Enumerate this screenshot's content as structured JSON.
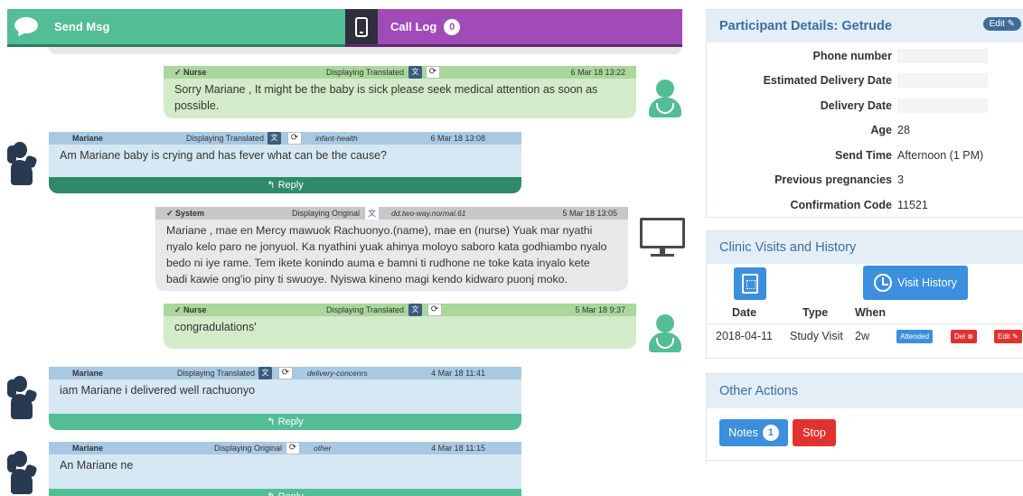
{
  "topbar": {
    "send_label": "Send Msg",
    "call_label": "Call Log",
    "call_count": "0",
    "send_color": "#53bd96",
    "call_color": "#a14bb8"
  },
  "feed": {
    "msg1": {
      "from": "✓ Nurse",
      "display": "Displaying Translated",
      "date": "6 Mar 18 13:22",
      "text": "Sorry Mariane , It might be the baby is sick please seek medical attention as soon as possible."
    },
    "msg2": {
      "from": "Mariane",
      "display": "Displaying Translated",
      "tag": "infant-health",
      "date": "6 Mar 18 13:08",
      "text": "Am Mariane baby is crying and has fever what can be the cause?",
      "reply": "↰ Reply"
    },
    "msg3": {
      "from": "✓ System",
      "display": "Displaying Original",
      "tag": "dd.two-way.normal.61",
      "date": "5 Mar 18 13:05",
      "text": "Mariane , mae en Mercy mawuok Rachuonyo.(name), mae en (nurse) Yuak mar nyathi nyalo kelo paro ne jonyuol. Ka nyathini yuak ahinya moloyo saboro kata godhiambo nyalo bedo ni iye rame. Tem ikete konindo auma e bamni ti rudhone ne toke kata inyalo kete badi kawie ong'io piny ti swuoye. Nyiswa kineno magi kendo kidwaro puonj moko."
    },
    "msg4": {
      "from": "✓ Nurse",
      "display": "Displaying Translated",
      "date": "5 Mar 18 9:37",
      "text": "congradulations'"
    },
    "msg5": {
      "from": "Mariane",
      "display": "Displaying Translated",
      "tag": "delivery-concenrs",
      "date": "4 Mar 18 11:41",
      "text": "iam Mariane i delivered well rachuonyo",
      "reply": "↰ Reply"
    },
    "msg6": {
      "from": "Mariane",
      "display": "Displaying Original",
      "tag": "other",
      "date": "4 Mar 18 11:15",
      "text": "An Mariane  ne",
      "reply": "↰ Reply"
    }
  },
  "participant": {
    "title": "Participant Details: Getrude",
    "edit_label": "Edit ✎",
    "rows": [
      {
        "label": "Phone number",
        "value": ""
      },
      {
        "label": "Estimated Delivery Date",
        "value": ""
      },
      {
        "label": "Delivery Date",
        "value": ""
      },
      {
        "label": "Age",
        "value": "28"
      },
      {
        "label": "Send Time",
        "value": "Afternoon (1 PM)"
      },
      {
        "label": "Previous pregnancies",
        "value": "3"
      },
      {
        "label": "Confirmation Code",
        "value": "11521"
      }
    ]
  },
  "clinic": {
    "title": "Clinic Visits and History",
    "visit_history_label": "Visit History",
    "headers": [
      "Date",
      "Type",
      "When"
    ],
    "rows": [
      {
        "date": "2018-04-11",
        "type": "Study Visit",
        "when": "2w",
        "status": "Attended",
        "del": "Del ⊗",
        "edit": "Edit ✎"
      }
    ]
  },
  "other_actions": {
    "title": "Other Actions",
    "notes_label": "Notes",
    "notes_count": "1",
    "stop_label": "Stop"
  },
  "colors": {
    "accent_blue": "#3c8fdd",
    "danger_red": "#e0332f",
    "panel_title": "#3b6fa0"
  }
}
